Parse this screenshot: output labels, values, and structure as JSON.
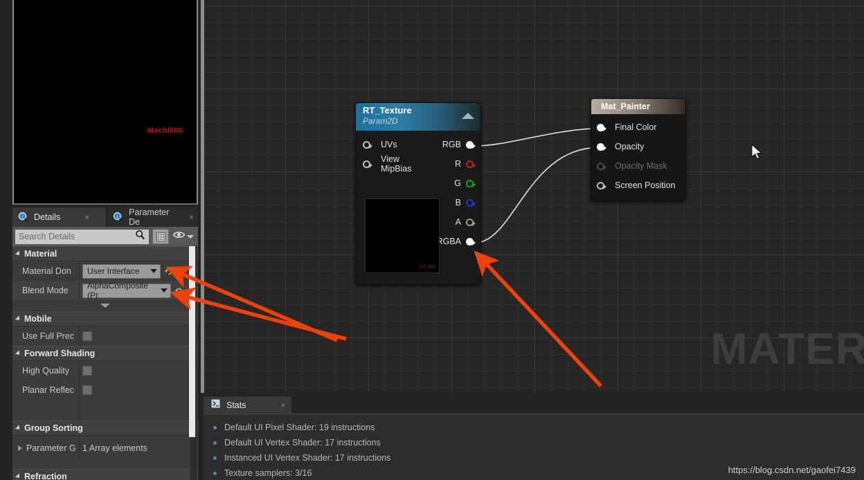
{
  "viewport": {
    "watermark": "Machl666"
  },
  "tabs": [
    {
      "label": "Details",
      "icon": "details-magnifier-icon",
      "close": "×",
      "active": true
    },
    {
      "label": "Parameter De",
      "icon": "parameter-defaults-icon",
      "close": "×",
      "active": false
    }
  ],
  "search": {
    "placeholder": "Search Details",
    "value": "",
    "icon": "search-icon",
    "grid_button": "column-view-icon",
    "eye_button": "visibility-eye-icon",
    "eye_caret": "chevron-down-icon"
  },
  "details": {
    "categories": [
      {
        "name": "Material",
        "rows": [
          {
            "label": "Material Don",
            "type": "combo",
            "value": "User Interface",
            "reset_icon": "reset-arrow-icon"
          },
          {
            "label": "Blend Mode",
            "type": "combo",
            "value": "AlphaComposite (Pr",
            "reset_icon": "reset-arrow-icon"
          }
        ],
        "expander": "chevron-down-icon"
      },
      {
        "name": "Mobile",
        "rows": [
          {
            "label": "Use Full Prec",
            "type": "checkbox",
            "value": ""
          }
        ]
      },
      {
        "name": "Forward Shading",
        "rows": [
          {
            "label": "High Quality",
            "type": "checkbox",
            "value": ""
          },
          {
            "label": "Planar Reflec",
            "type": "checkbox",
            "value": ""
          }
        ]
      },
      {
        "name": "Group Sorting",
        "rows": [
          {
            "label": "Parameter G",
            "type": "expandable",
            "value": "1 Array elements"
          }
        ]
      },
      {
        "name": "Refraction",
        "rows": []
      }
    ]
  },
  "graph": {
    "background_text": "MATER",
    "cursor": "mouse-pointer",
    "nodes": [
      {
        "id": "rt-texture",
        "title": "RT_Texture",
        "subtitle": "Param2D",
        "collapse_icon": "collapse-triangle-icon",
        "thumbnail_mark": "RT_TEX",
        "inputs": [
          {
            "label": "UVs",
            "style": "hollow"
          },
          {
            "label": "View MipBias",
            "style": "hollow"
          }
        ],
        "outputs": [
          {
            "label": "RGB",
            "style": "filled"
          },
          {
            "label": "R",
            "style": "red"
          },
          {
            "label": "G",
            "style": "green"
          },
          {
            "label": "B",
            "style": "blue"
          },
          {
            "label": "A",
            "style": "gray"
          },
          {
            "label": "RGBA",
            "style": "filled"
          }
        ]
      },
      {
        "id": "mat-painter",
        "title": "Mat_Painter",
        "inputs": [
          {
            "label": "Final Color",
            "style": "filled",
            "disabled": false
          },
          {
            "label": "Opacity",
            "style": "filled",
            "disabled": false
          },
          {
            "label": "Opacity Mask",
            "style": "dimmed",
            "disabled": true
          },
          {
            "label": "Screen Position",
            "style": "hollow",
            "disabled": false
          }
        ]
      }
    ],
    "connections": [
      {
        "from": "RGB",
        "to": "Final Color"
      },
      {
        "from": "RGBA",
        "to": "Opacity"
      }
    ],
    "annotations": [
      {
        "name": "arrow-to-material-domain",
        "color": "#f2400c"
      },
      {
        "name": "arrow-to-blend-mode",
        "color": "#f2400c"
      },
      {
        "name": "arrow-to-rgba-pin",
        "color": "#f2400c"
      }
    ]
  },
  "stats": {
    "tab_label": "Stats",
    "tab_icon": "stats-script-icon",
    "tab_close": "×",
    "lines": [
      "Default UI Pixel Shader: 19 instructions",
      "Default UI Vertex Shader: 17 instructions",
      "Instanced UI Vertex Shader: 17 instructions",
      "Texture samplers: 3/16"
    ]
  },
  "watermark": {
    "url": "https://blog.csdn.net/gaofei7439"
  },
  "colors": {
    "accent_orange": "#f2400c",
    "node_blue": "#2c7ea8",
    "node_tan": "#b8ada0",
    "pin_red": "#c21b12",
    "pin_green": "#0fa621",
    "pin_blue": "#1c38d8"
  }
}
